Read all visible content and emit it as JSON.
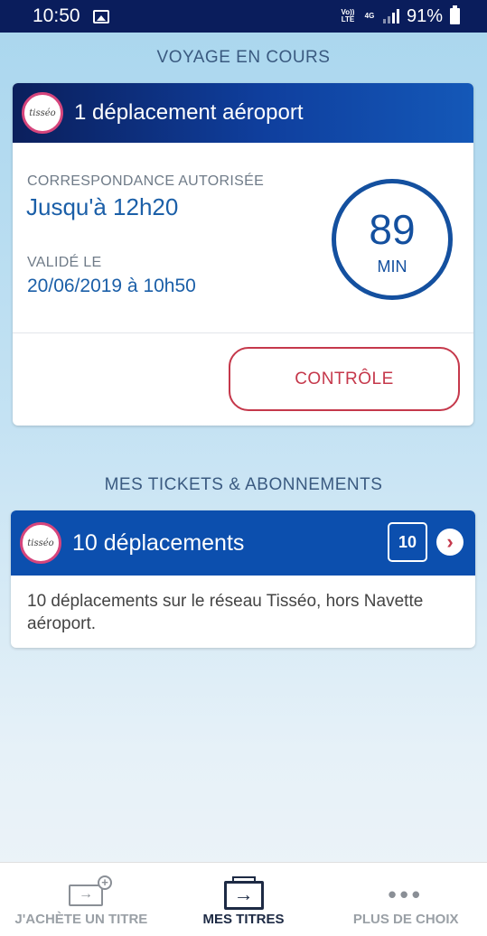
{
  "status_bar": {
    "time": "10:50",
    "volte": "Vo)) LTE",
    "network": "4G",
    "battery": "91%"
  },
  "current_trip": {
    "section_title": "VOYAGE EN COURS",
    "logo_text": "tisséo",
    "title": "1 déplacement aéroport",
    "transfer_label": "CORRESPONDANCE AUTORISÉE",
    "transfer_value": "Jusqu'à 12h20",
    "validated_label": "VALIDÉ LE",
    "validated_value": "20/06/2019 à 10h50",
    "countdown_value": "89",
    "countdown_unit": "MIN",
    "control_button": "CONTRÔLE"
  },
  "tickets": {
    "section_title": "MES TICKETS & ABONNEMENTS",
    "items": [
      {
        "logo_text": "tisséo",
        "title": "10 déplacements",
        "count_badge": "10",
        "description": "10 déplacements sur le réseau Tisséo, hors Navette aéroport."
      }
    ]
  },
  "bottom_nav": {
    "items": [
      {
        "label": "J'ACHÈTE UN TITRE",
        "icon": "buy-ticket-icon"
      },
      {
        "label": "MES TITRES",
        "icon": "my-tickets-icon",
        "active": true
      },
      {
        "label": "PLUS DE CHOIX",
        "icon": "more-dots-icon"
      }
    ]
  },
  "colors": {
    "header_blue": "#0b1f5c",
    "accent_blue": "#14509f",
    "control_red": "#c5384b"
  }
}
